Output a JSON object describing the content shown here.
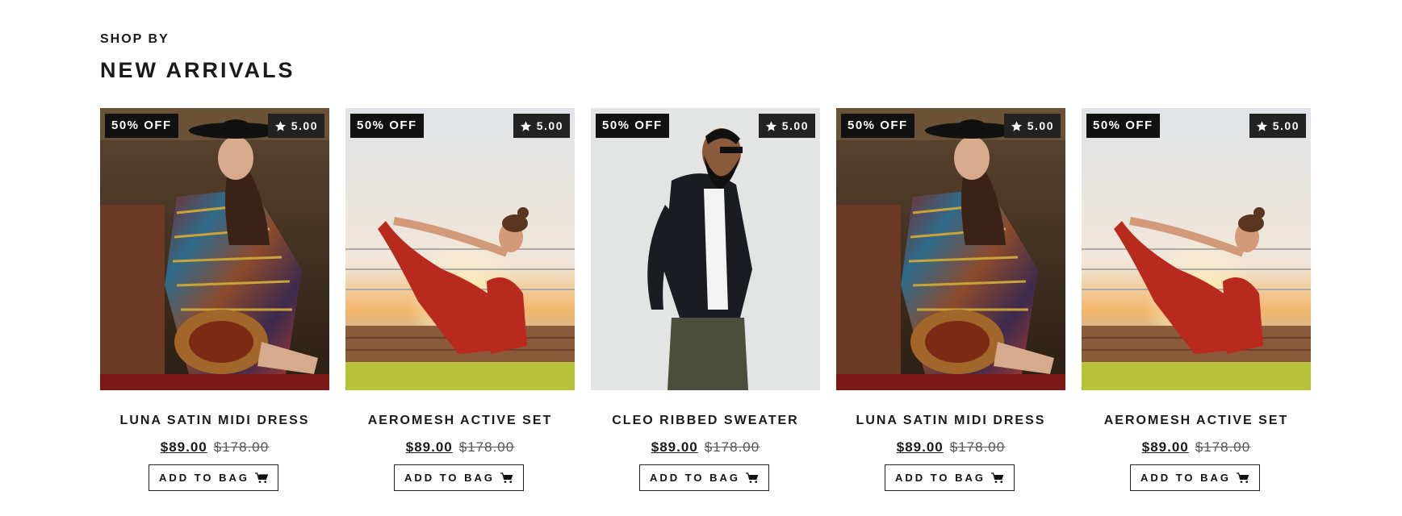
{
  "section": {
    "eyebrow": "SHOP BY",
    "title": "NEW ARRIVALS"
  },
  "products": [
    {
      "name": "LUNA SATIN MIDI DRESS",
      "discount": "50% OFF",
      "rating": "5.00",
      "price": "$89.00",
      "original_price": "$178.00",
      "button": "ADD TO BAG",
      "image": "woman-in-striped-knit-dress-and-hat"
    },
    {
      "name": "AEROMESH ACTIVE SET",
      "discount": "50% OFF",
      "rating": "5.00",
      "price": "$89.00",
      "original_price": "$178.00",
      "button": "ADD TO BAG",
      "image": "woman-doing-yoga-on-pier-at-sunset"
    },
    {
      "name": "CLEO RIBBED SWEATER",
      "discount": "50% OFF",
      "rating": "5.00",
      "price": "$89.00",
      "original_price": "$178.00",
      "button": "ADD TO BAG",
      "image": "bearded-man-in-black-blazer"
    },
    {
      "name": "LUNA SATIN MIDI DRESS",
      "discount": "50% OFF",
      "rating": "5.00",
      "price": "$89.00",
      "original_price": "$178.00",
      "button": "ADD TO BAG",
      "image": "woman-in-striped-knit-dress-and-hat"
    },
    {
      "name": "AEROMESH ACTIVE SET",
      "discount": "50% OFF",
      "rating": "5.00",
      "price": "$89.00",
      "original_price": "$178.00",
      "button": "ADD TO BAG",
      "image": "woman-doing-yoga-on-pier-at-sunset"
    }
  ],
  "icons": {
    "rating": "star-icon",
    "cart": "cart-icon"
  }
}
